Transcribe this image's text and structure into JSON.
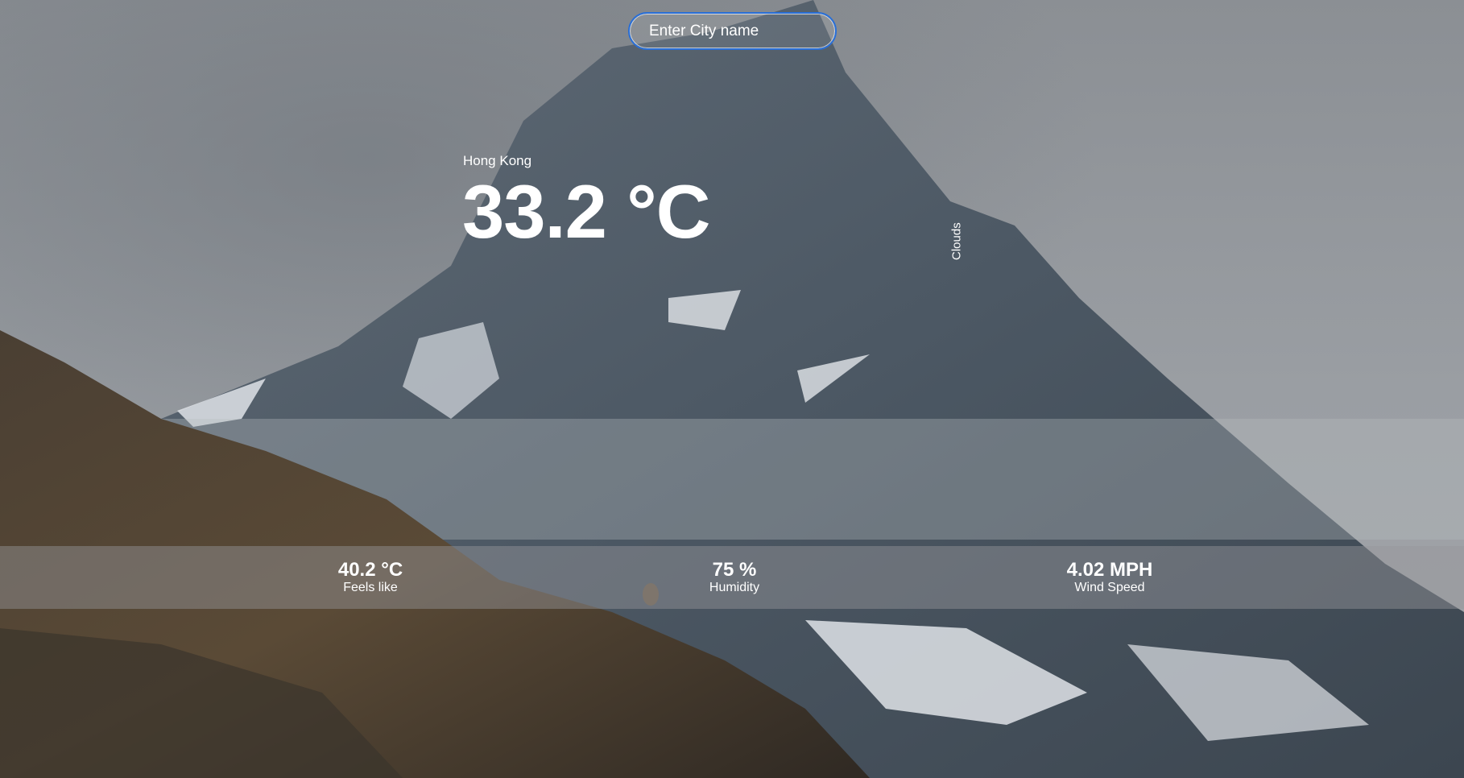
{
  "search": {
    "placeholder": "Enter City name"
  },
  "weather": {
    "city": "Hong Kong",
    "temperature": "33.2 °C",
    "condition": "Clouds"
  },
  "stats": [
    {
      "value": "40.2 °C",
      "label": "Feels like"
    },
    {
      "value": "75 %",
      "label": "Humidity"
    },
    {
      "value": "4.02 MPH",
      "label": "Wind Speed"
    }
  ],
  "colors": {
    "search_border": "#2a6fd6",
    "text": "#ffffff",
    "bar_background": "#96969b"
  }
}
